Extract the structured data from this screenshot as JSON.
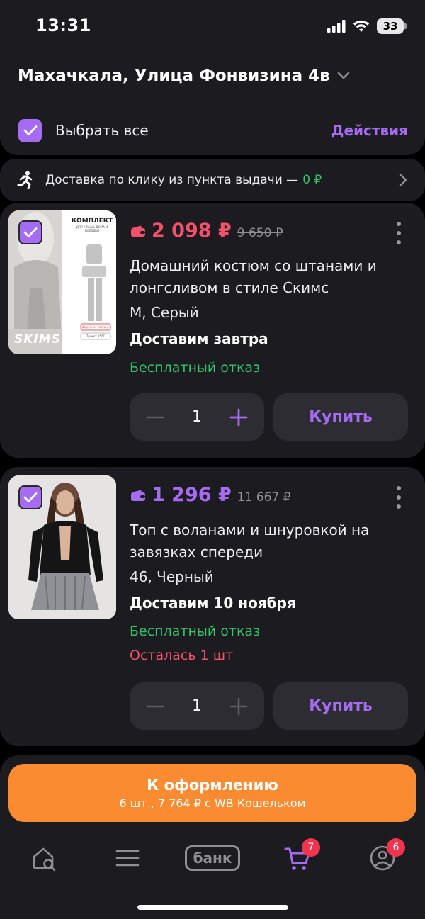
{
  "status_bar": {
    "time": "13:31",
    "battery": "33"
  },
  "header": {
    "address": "Махачкала, Улица Фонвизина 4в",
    "select_all_label": "Выбрать все",
    "actions_label": "Действия"
  },
  "delivery_banner": {
    "text": "Доставка по клику из пункта выдачи —",
    "price": "0 ₽"
  },
  "products": [
    {
      "price": "2 098 ₽",
      "old_price": "9 650 ₽",
      "price_color": "#f3506b",
      "title": "Домашний костюм со штанами и лонгсливом в стиле Скимс",
      "variant": "M, Серый",
      "delivery": "Доставим завтра",
      "return_policy": "Бесплатный отказ",
      "quantity": "1",
      "buy_label": "Купить",
      "image": {
        "heading": "КОМПЛЕКТ",
        "subheading": "ДЛЯ УЛИЦЫ, ДОМА И ПОЕЗДКИ",
        "brand": "SKIMS",
        "tag1": "Шорты из Россини",
        "tag2": "Трикот 250Г"
      }
    },
    {
      "price": "1 296 ₽",
      "old_price": "11 667 ₽",
      "price_color": "#a56cf3",
      "title": "Топ с воланами и шнуровкой на завязках спереди",
      "variant": "46, Черный",
      "delivery": "Доставим 10 ноября",
      "return_policy": "Бесплатный отказ",
      "stock_note": "Осталась 1 шт",
      "quantity": "1",
      "buy_label": "Купить"
    }
  ],
  "checkout": {
    "label": "К оформлению",
    "summary": "6 шт., 7 764 ₽ с WB Кошельком"
  },
  "tab_bar": {
    "bank_label": "банк",
    "cart_badge": "7",
    "profile_badge": "6"
  },
  "colors": {
    "accent": "#a56cf3",
    "sale": "#f3506b",
    "success": "#2ec46a",
    "checkout": "#fb8b30",
    "card": "#1c1b20"
  }
}
